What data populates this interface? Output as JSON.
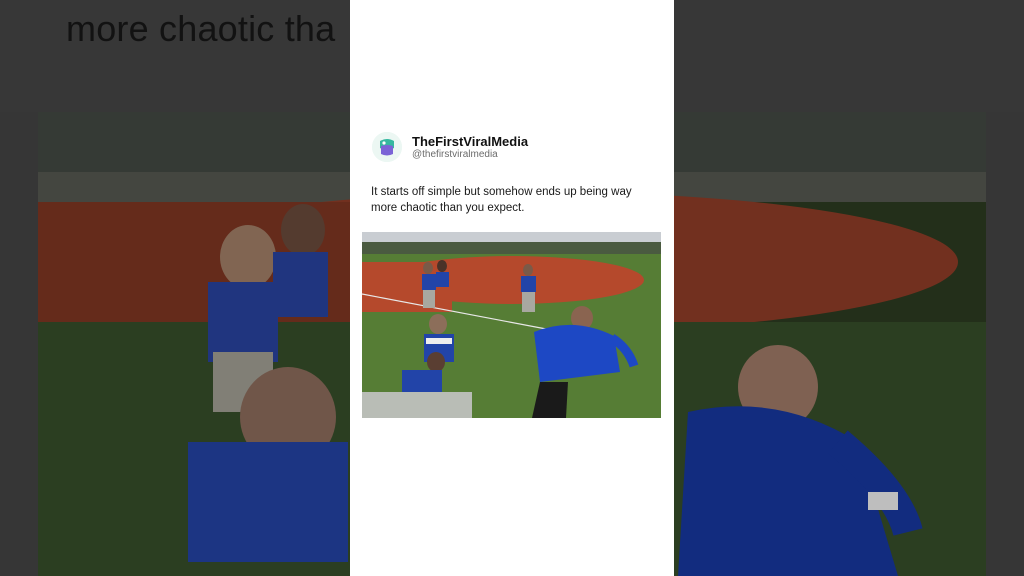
{
  "background": {
    "caption_fragment": "more chaotic tha"
  },
  "tweet": {
    "display_name": "TheFirstViralMedia",
    "handle": "@thefirstviralmedia",
    "text": "It starts off simple but somehow ends up being way more chaotic than you expect."
  },
  "colors": {
    "card_bg": "#ffffff",
    "backdrop": "#3c3c3c",
    "infield_dirt": "#b2482c",
    "outfield_grass": "#4f7a32",
    "jersey_blue": "#1f47b8"
  },
  "icons": {
    "avatar": "brand-logo-icon"
  }
}
